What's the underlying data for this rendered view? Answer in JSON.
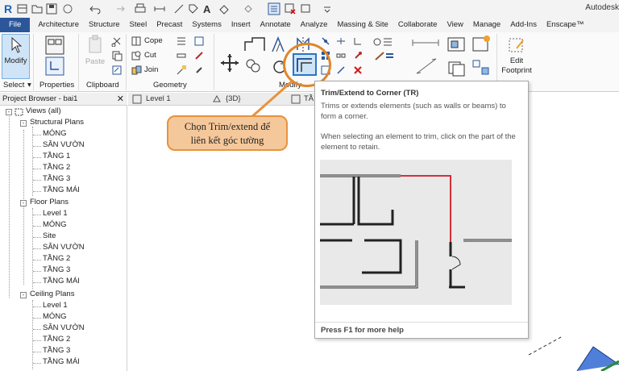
{
  "titlebar": {
    "app_name": "Autodesk"
  },
  "tabs": [
    "File",
    "Architecture",
    "Structure",
    "Steel",
    "Precast",
    "Systems",
    "Insert",
    "Annotate",
    "Analyze",
    "Massing & Site",
    "Collaborate",
    "View",
    "Manage",
    "Add-Ins",
    "Enscape™"
  ],
  "ribbon": {
    "modify_label": "Modify",
    "paste_label": "Paste",
    "properties_label": "Properties",
    "cope_label": "Cope",
    "cut_label": "Cut",
    "join_label": "Join",
    "edit_footprint_label": "Edit\nFootprint",
    "edit_label": "Edit",
    "footprint_label": "Footprint",
    "panels": {
      "select": "Select",
      "properties": "Properties",
      "clipboard": "Clipboard",
      "geometry": "Geometry",
      "modify": "Modify"
    }
  },
  "project_browser": {
    "title": "Project Browser - bai1",
    "close": "✕",
    "root": "Views (all)",
    "groups": [
      {
        "label": "Structural Plans",
        "items": [
          "MÓNG",
          "SÂN VƯỜN",
          "TẦNG 1",
          "TẦNG 2",
          "TẦNG 3",
          "TẦNG MÁI"
        ]
      },
      {
        "label": "Floor Plans",
        "items": [
          "Level 1",
          "MÓNG",
          "Site",
          "SÂN VƯỜN",
          "TẦNG 2",
          "TẦNG 3",
          "TẦNG MÁI"
        ]
      },
      {
        "label": "Ceiling Plans",
        "items": [
          "Level 1",
          "MÓNG",
          "SÂN VƯỜN",
          "TẦNG 2",
          "TẦNG 3",
          "TẦNG MÁI"
        ]
      }
    ]
  },
  "view_tabs": [
    "Level 1",
    "{3D}",
    "TẦ"
  ],
  "callout": {
    "line1": "Chọn Trim/extend để",
    "line2": "liên kết góc tường"
  },
  "tooltip": {
    "title": "Trim/Extend to Corner (TR)",
    "desc": "Trims or extends elements (such as walls or beams) to form a corner.",
    "detail": "When selecting an element to trim, click on the part of the element to retain.",
    "footer": "Press F1 for more help"
  },
  "colors": {
    "accent": "#2b579a",
    "highlight": "#e0862a",
    "callout_bg": "#f5c89b"
  }
}
